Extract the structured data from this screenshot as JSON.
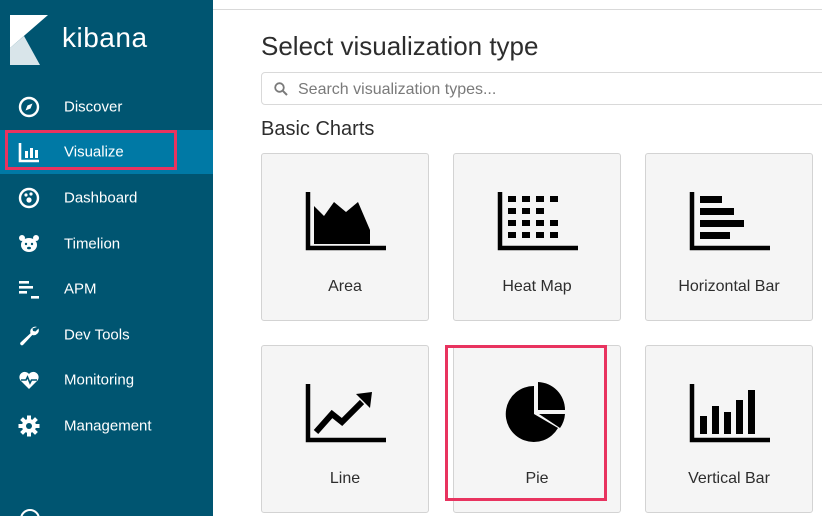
{
  "app": {
    "brand": "kibana"
  },
  "sidebar": {
    "items": [
      {
        "label": "Discover",
        "icon": "compass-icon"
      },
      {
        "label": "Visualize",
        "icon": "bar-chart-icon",
        "active": true
      },
      {
        "label": "Dashboard",
        "icon": "dashboard-icon"
      },
      {
        "label": "Timelion",
        "icon": "timelion-icon"
      },
      {
        "label": "APM",
        "icon": "apm-icon"
      },
      {
        "label": "Dev Tools",
        "icon": "wrench-icon"
      },
      {
        "label": "Monitoring",
        "icon": "heartbeat-icon"
      },
      {
        "label": "Management",
        "icon": "gear-icon"
      }
    ]
  },
  "main": {
    "title": "Select visualization type",
    "search": {
      "placeholder": "Search visualization types..."
    },
    "section": "Basic Charts",
    "cards": [
      {
        "label": "Area",
        "icon": "area-chart-icon"
      },
      {
        "label": "Heat Map",
        "icon": "heat-map-icon"
      },
      {
        "label": "Horizontal Bar",
        "icon": "horizontal-bar-icon"
      },
      {
        "label": "Line",
        "icon": "line-chart-icon"
      },
      {
        "label": "Pie",
        "icon": "pie-chart-icon"
      },
      {
        "label": "Vertical Bar",
        "icon": "vertical-bar-icon"
      }
    ]
  },
  "colors": {
    "sidebar_bg": "#005571",
    "sidebar_active": "#0079a5",
    "highlight": "#e8335f",
    "card_bg": "#f5f5f5"
  }
}
